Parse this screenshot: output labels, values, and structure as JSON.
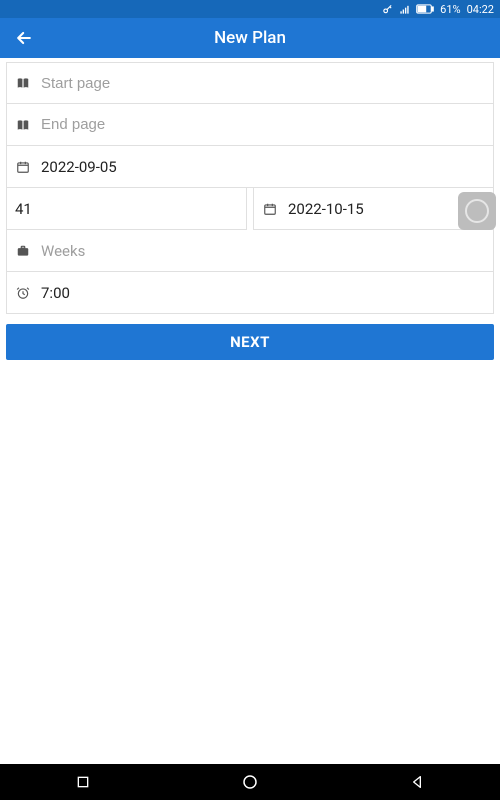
{
  "status": {
    "battery": "61%",
    "time": "04:22"
  },
  "header": {
    "title": "New Plan"
  },
  "form": {
    "start_page_placeholder": "Start page",
    "end_page_placeholder": "End page",
    "date_start": "2022-09-05",
    "number_value": "41",
    "date_end": "2022-10-15",
    "weeks_placeholder": "Weeks",
    "time_value": "7:00"
  },
  "actions": {
    "next_label": "NEXT"
  }
}
